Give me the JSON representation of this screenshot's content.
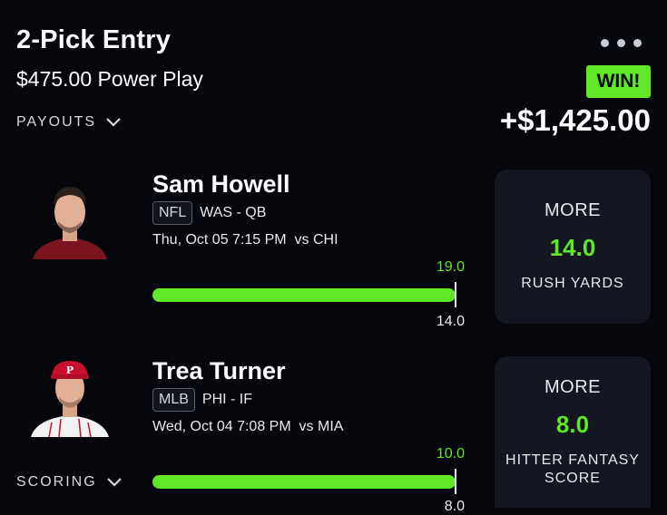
{
  "entry": {
    "title": "2-Pick Entry",
    "subtitle": "$475.00 Power Play",
    "result_badge": "WIN!",
    "payout": "+$1,425.00",
    "payouts_label": "PAYOUTS",
    "scoring_label": "SCORING",
    "more_icon": "more-horizontal-icon"
  },
  "colors": {
    "background": "#06070d",
    "accent": "#5fe825",
    "card": "#141722"
  },
  "picks": [
    {
      "player": "Sam Howell",
      "league": "NFL",
      "team_pos": "WAS - QB",
      "game": "Thu, Oct 05 7:15 PM  vs CHI",
      "actual": "19.0",
      "line": "14.0",
      "direction": "MORE",
      "pick_line": "14.0",
      "stat": "RUSH YARDS"
    },
    {
      "player": "Trea Turner",
      "league": "MLB",
      "team_pos": "PHI - IF",
      "game": "Wed, Oct 04 7:08 PM  vs MIA",
      "actual": "10.0",
      "line": "8.0",
      "direction": "MORE",
      "pick_line": "8.0",
      "stat": "HITTER FANTASY SCORE"
    }
  ]
}
